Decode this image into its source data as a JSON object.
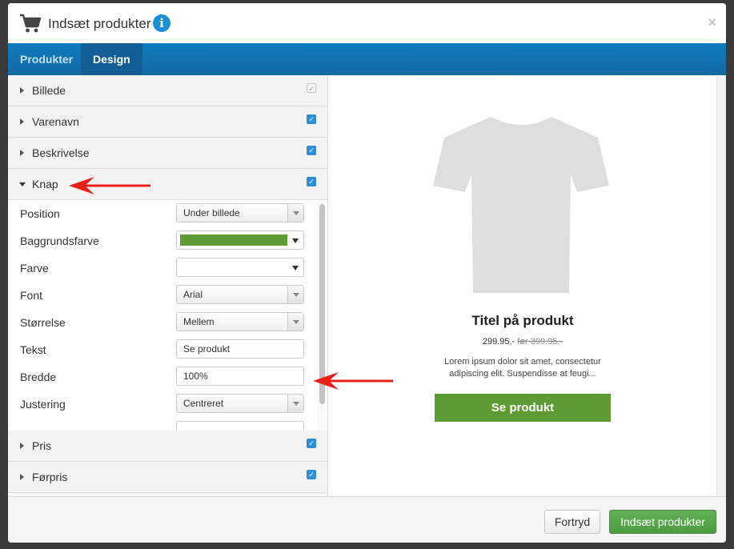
{
  "modal": {
    "title": "Indsæt produkter",
    "info_glyph": "i",
    "close_glyph": "×",
    "icons": {
      "cart": "cart-icon",
      "info": "info-icon",
      "close": "close-icon"
    }
  },
  "tabs": [
    {
      "label": "Produkter",
      "active": false
    },
    {
      "label": "Design",
      "active": true
    }
  ],
  "sections": {
    "billede": {
      "label": "Billede",
      "checked": true,
      "disabled": true
    },
    "varenavn": {
      "label": "Varenavn",
      "checked": true
    },
    "beskrivelse": {
      "label": "Beskrivelse",
      "checked": true
    },
    "knap": {
      "label": "Knap",
      "checked": true,
      "expanded": true
    },
    "pris": {
      "label": "Pris",
      "checked": true
    },
    "forpris": {
      "label": "Førpris",
      "checked": true
    }
  },
  "knap_settings": {
    "position": {
      "label": "Position",
      "value": "Under billede"
    },
    "baggrundsfarve": {
      "label": "Baggrundsfarve",
      "value_color": "#5f9b34"
    },
    "farve": {
      "label": "Farve",
      "value": ""
    },
    "font": {
      "label": "Font",
      "value": "Arial"
    },
    "storrelse": {
      "label": "Størrelse",
      "value": "Mellem"
    },
    "tekst": {
      "label": "Tekst",
      "value": "Se produkt"
    },
    "bredde": {
      "label": "Bredde",
      "value": "100%"
    },
    "justering": {
      "label": "Justering",
      "value": "Centreret"
    }
  },
  "checkmark_glyph": "✓",
  "preview": {
    "title": "Titel på produkt",
    "price": "299.95,-",
    "old_price": "før 399.95,-",
    "description_line1": "Lorem ipsum dolor sit amet, consectetur",
    "description_line2": "adipiscing elit. Suspendisse at feugi...",
    "button_label": "Se produkt",
    "button_color": "#5f9b34"
  },
  "footer": {
    "cancel_label": "Fortryd",
    "insert_label": "Indsæt produkter"
  },
  "colors": {
    "tabbar": "#1569a2",
    "accent_green": "#5f9b34",
    "checkbox_blue": "#2f8ed9",
    "annotation_arrow": "#e8201a"
  }
}
